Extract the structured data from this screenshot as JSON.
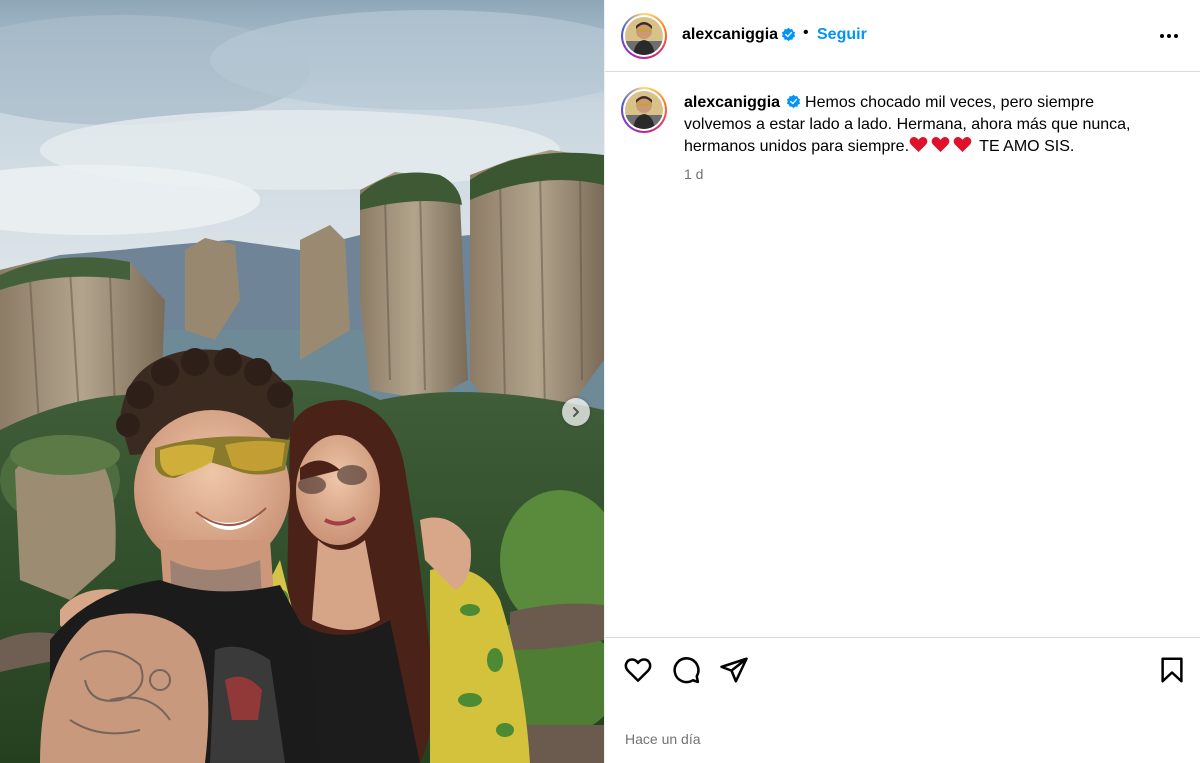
{
  "post": {
    "username": "alexcaniggia",
    "follow_label": "Seguir",
    "separator": "•",
    "caption_text": "Hemos chocado mil veces, pero siempre volvemos a estar lado a lado. Hermana, ahora más que nunca, hermanos unidos para siempre.",
    "caption_suffix": "TE AMO SIS.",
    "caption_time": "1 d",
    "post_date": "Hace un día"
  },
  "icons": {
    "verified": "verified-badge-icon",
    "more": "more-options-icon",
    "next": "chevron-right-icon",
    "like": "heart-icon",
    "comment": "comment-icon",
    "share": "paper-plane-icon",
    "save": "bookmark-icon"
  },
  "colors": {
    "accent": "#0095f6",
    "muted_text": "#737373",
    "verified": "#0095f6",
    "heart_emoji": "#e0112b"
  }
}
